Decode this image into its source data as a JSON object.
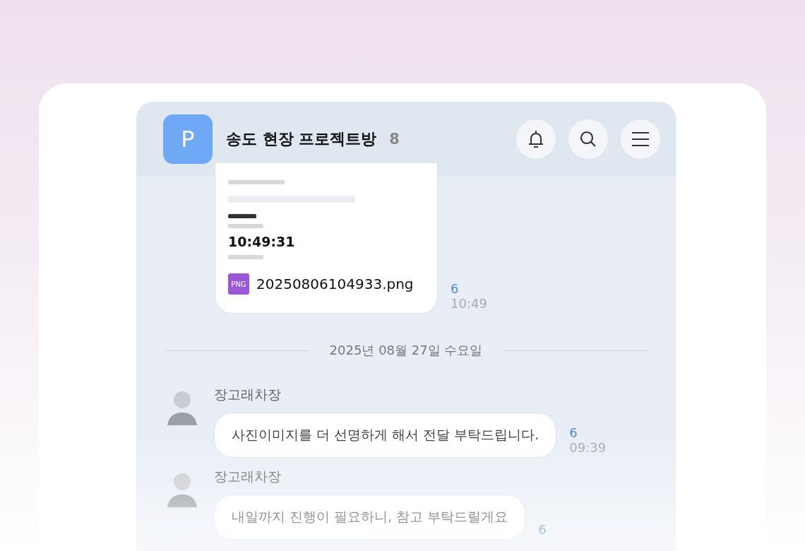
{
  "header": {
    "avatar_letter": "P",
    "title": "송도 현장 프로젝트방",
    "member_count": "8"
  },
  "messages": [
    {
      "kind": "image",
      "preview_time": "10:49:31",
      "file_name": "20250806104933.png",
      "file_badge": "PNG",
      "unread": "6",
      "time": "10:49"
    },
    {
      "kind": "date",
      "text": "2025년 08월 27일 수요일"
    },
    {
      "kind": "text",
      "sender": "장고래차장",
      "text": "사진이미지를 더 선명하게 해서 전달 부탁드립니다.",
      "unread": "6",
      "time": "09:39"
    },
    {
      "kind": "text",
      "sender": "장고래차장",
      "text": "내일까지 진행이 필요하니, 참고 부탁드릴게요",
      "unread": "6"
    }
  ]
}
